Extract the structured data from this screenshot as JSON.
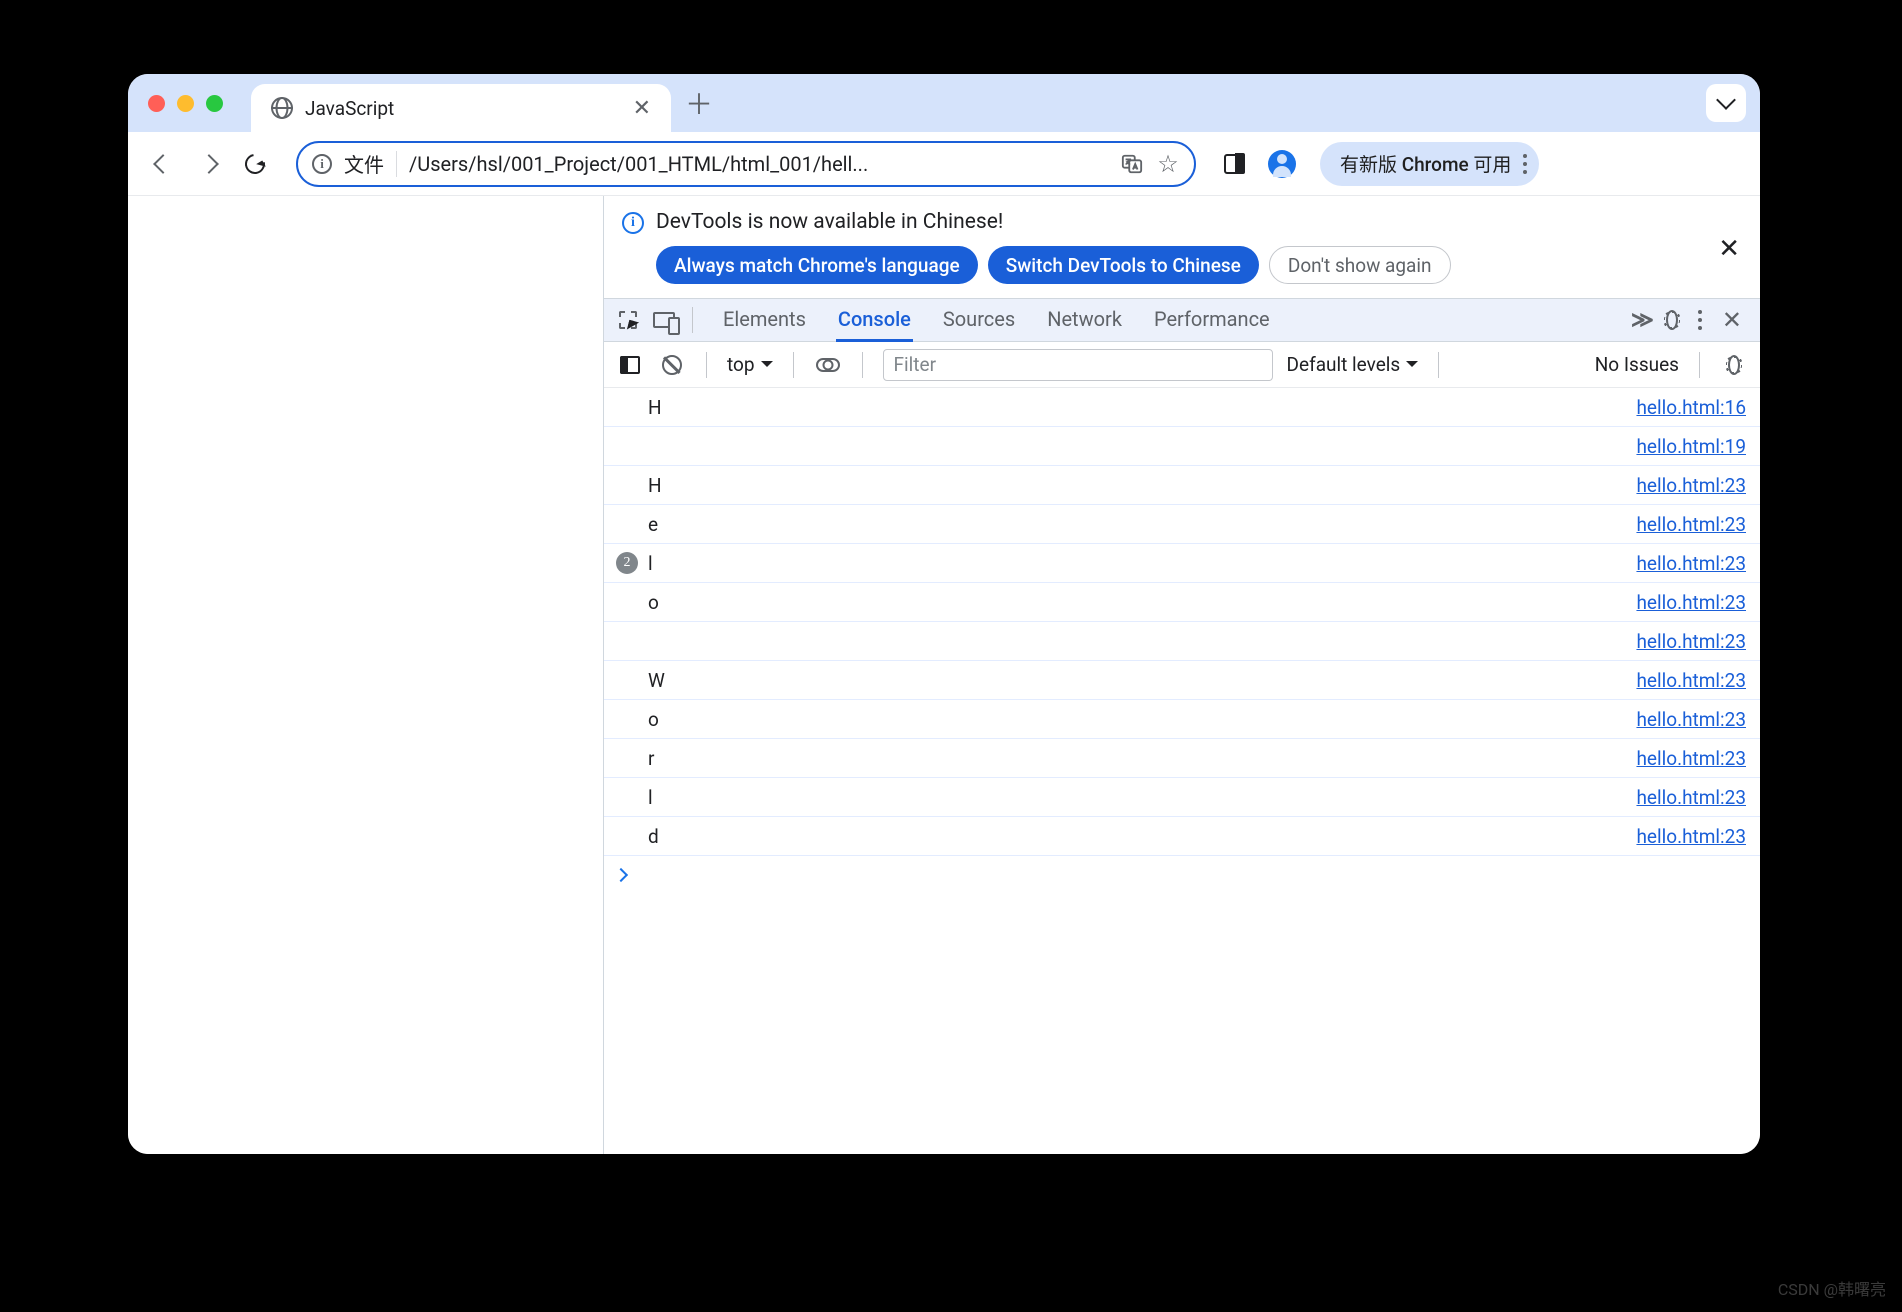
{
  "window": {
    "tab_title": "JavaScript",
    "new_tab_glyph": "＋",
    "close_glyph": "✕"
  },
  "toolbar": {
    "file_label": "文件",
    "path": "/Users/hsl/001_Project/001_HTML/html_001/hell...",
    "translate_glyph": "⁂",
    "star_glyph": "☆",
    "update_label": "有新版 Chrome 可用"
  },
  "devtools": {
    "banner_msg": "DevTools is now available in Chinese!",
    "btn_match": "Always match Chrome's language",
    "btn_switch": "Switch DevTools to Chinese",
    "btn_dont": "Don't show again",
    "tabs": {
      "elements": "Elements",
      "console": "Console",
      "sources": "Sources",
      "network": "Network",
      "performance": "Performance"
    },
    "more_glyph": "≫",
    "ctx": "top",
    "filter_placeholder": "Filter",
    "levels": "Default levels",
    "issues": "No Issues"
  },
  "log": [
    {
      "badge": "",
      "msg": "H",
      "src": "hello.html:16"
    },
    {
      "badge": "",
      "msg": "",
      "src": "hello.html:19"
    },
    {
      "badge": "",
      "msg": "H",
      "src": "hello.html:23"
    },
    {
      "badge": "",
      "msg": "e",
      "src": "hello.html:23"
    },
    {
      "badge": "2",
      "msg": "l",
      "src": "hello.html:23"
    },
    {
      "badge": "",
      "msg": "o",
      "src": "hello.html:23"
    },
    {
      "badge": "",
      "msg": "",
      "src": "hello.html:23"
    },
    {
      "badge": "",
      "msg": "W",
      "src": "hello.html:23"
    },
    {
      "badge": "",
      "msg": "o",
      "src": "hello.html:23"
    },
    {
      "badge": "",
      "msg": "r",
      "src": "hello.html:23"
    },
    {
      "badge": "",
      "msg": "l",
      "src": "hello.html:23"
    },
    {
      "badge": "",
      "msg": "d",
      "src": "hello.html:23"
    }
  ],
  "watermark": "CSDN @韩曙亮"
}
